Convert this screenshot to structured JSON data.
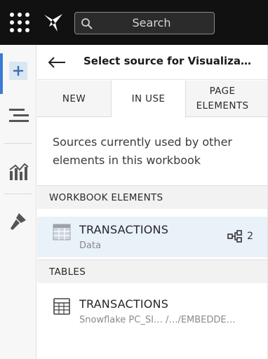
{
  "topbar": {
    "search_label": "Search"
  },
  "rail": {
    "items": [
      {
        "icon": "plus-icon",
        "active": true
      },
      {
        "icon": "layers-icon",
        "active": false
      },
      {
        "icon": "chart-icon",
        "active": false
      },
      {
        "icon": "brush-icon",
        "active": false
      }
    ]
  },
  "panel": {
    "title": "Select source for Visualization",
    "tabs": [
      {
        "label": "NEW"
      },
      {
        "label": "IN USE"
      },
      {
        "label": "PAGE\nELEMENTS"
      }
    ],
    "description": "Sources currently used by other elements in this workbook",
    "sections": {
      "workbook_elements": {
        "heading": "WORKBOOK ELEMENTS",
        "items": [
          {
            "name": "TRANSACTIONS",
            "sub": "Data",
            "count": "2"
          }
        ]
      },
      "tables": {
        "heading": "TABLES",
        "items": [
          {
            "name": "TRANSACTIONS",
            "sub": "Snowflake PC_SI… /…/EMBEDDE…"
          }
        ]
      }
    }
  },
  "colors": {
    "topbar_bg": "#111111",
    "accent": "#3a7bd5",
    "selected_row": "#e9f1f9"
  }
}
